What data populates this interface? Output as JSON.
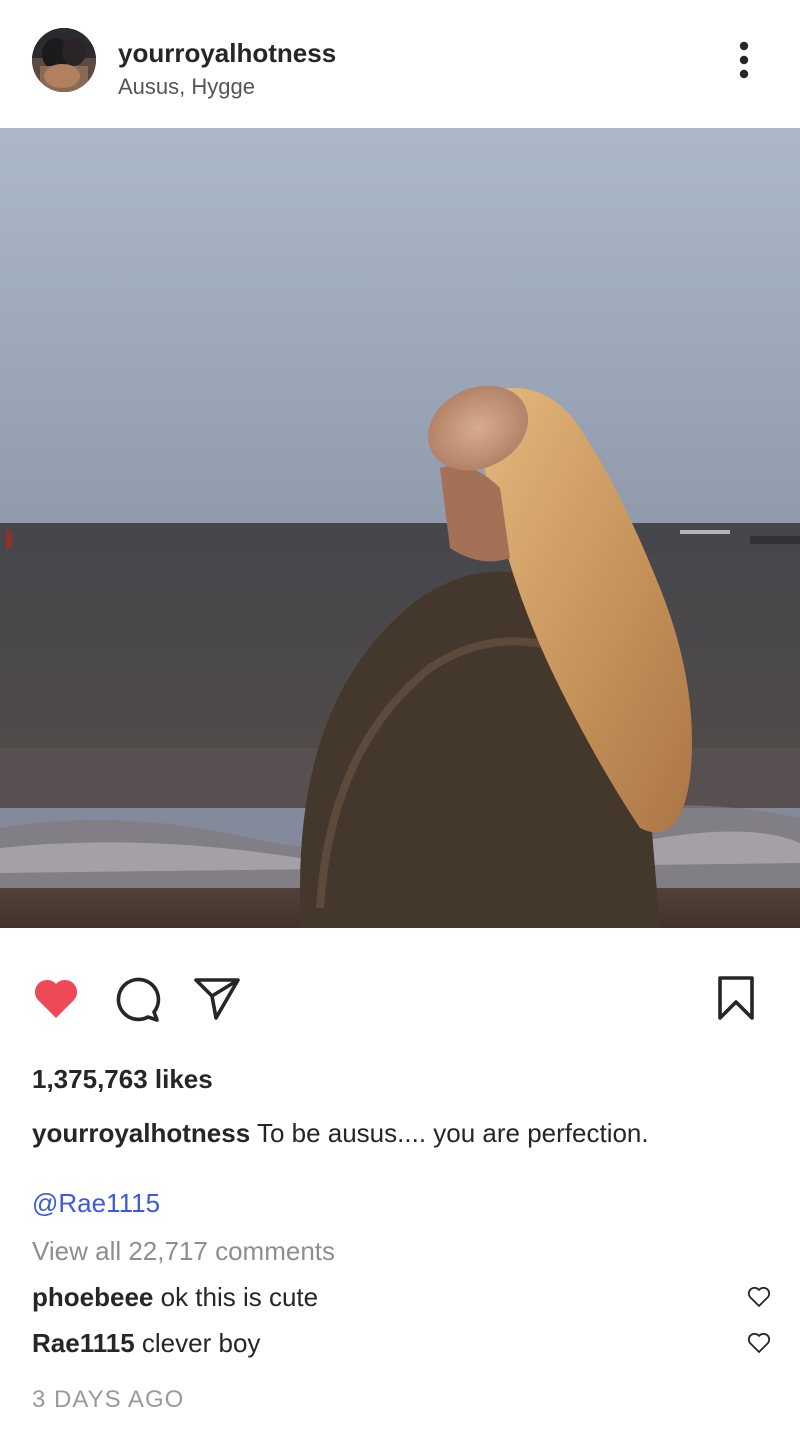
{
  "post": {
    "username": "yourroyalhotness",
    "location": "Ausus, Hygge",
    "likes_text": "1,375,763 likes",
    "caption_user": "yourroyalhotness",
    "caption_text": "To be ausus.... you are perfection.",
    "mention": "@Rae1115",
    "view_all_comments": "View all 22,717 comments",
    "timestamp": "3 DAYS AGO",
    "liked": true
  },
  "comments": [
    {
      "user": "phoebeee",
      "text": "ok this is cute"
    },
    {
      "user": "Rae1115",
      "text": "clever boy"
    }
  ],
  "icons": {
    "more": "more-vertical-icon",
    "like": "heart-icon",
    "comment": "comment-bubble-icon",
    "share": "paper-plane-icon",
    "save": "bookmark-icon",
    "comment_like": "heart-outline-icon"
  },
  "colors": {
    "like_red": "#ed4956",
    "mention_blue": "#3b5bdb",
    "muted_text": "#8e8e8e"
  }
}
